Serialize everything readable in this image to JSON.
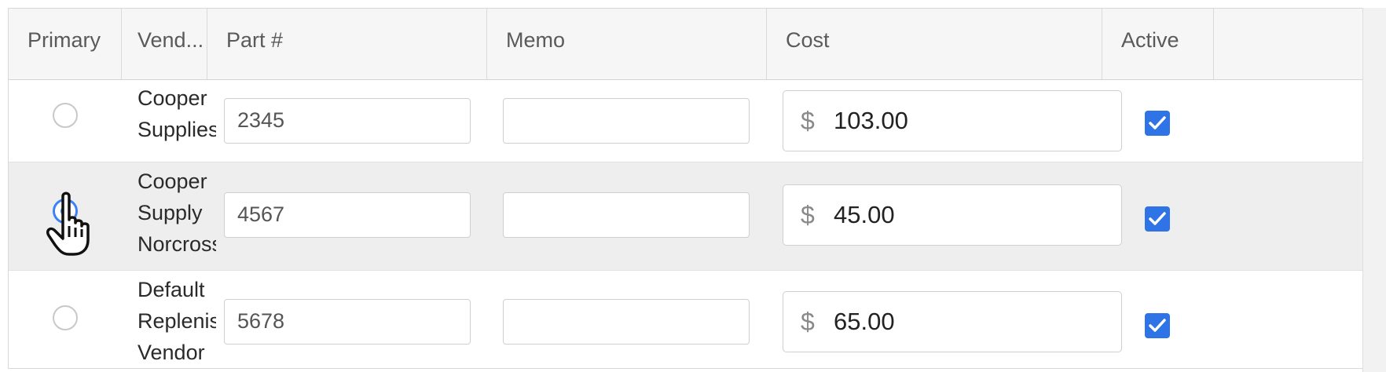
{
  "columns": [
    "Primary",
    "Vend...",
    "Part #",
    "Memo",
    "Cost",
    "Active"
  ],
  "currency_symbol": "$",
  "rows": [
    {
      "primary": false,
      "vendor_lines": [
        "Cooper",
        "Supplies"
      ],
      "part": "2345",
      "memo": "",
      "cost": "103.00",
      "active": true
    },
    {
      "primary": true,
      "vendor_lines": [
        "Cooper",
        "Supply",
        "Norcross"
      ],
      "part": "4567",
      "memo": "",
      "cost": "45.00",
      "active": true
    },
    {
      "primary": false,
      "vendor_lines": [
        "Default",
        "Replenishment",
        "Vendor"
      ],
      "part": "5678",
      "memo": "",
      "cost": "65.00",
      "active": true
    }
  ],
  "colors": {
    "accent": "#3b82f6",
    "checkbox": "#2f74e6",
    "selected_row": "#eeeeee"
  },
  "icons": {
    "cursor": "hand-pointer-icon",
    "check": "check-icon"
  }
}
